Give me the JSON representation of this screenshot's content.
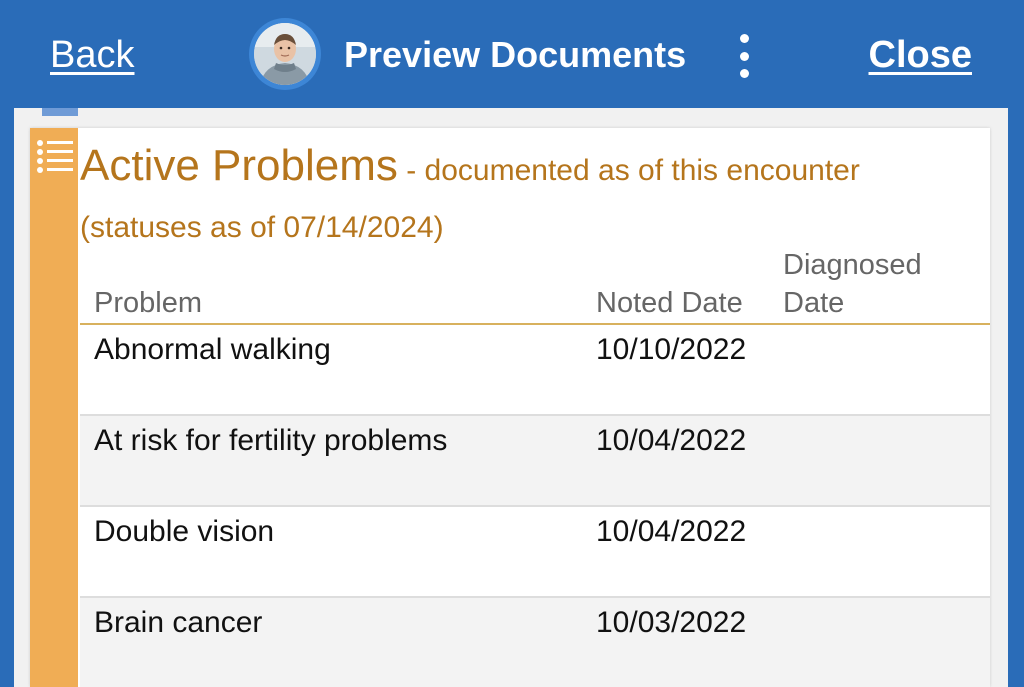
{
  "header": {
    "back_label": "Back",
    "title": "Preview Documents",
    "close_label": "Close"
  },
  "section": {
    "title": "Active Problems",
    "subtitle": " - documented as of this encounter (statuses as of 07/14/2024)"
  },
  "table": {
    "columns": [
      "Problem",
      "Noted Date",
      "Diagnosed Date"
    ],
    "rows": [
      {
        "problem": "Abnormal walking",
        "noted": "10/10/2022",
        "diagnosed": ""
      },
      {
        "problem": "At risk for fertility problems",
        "noted": "10/04/2022",
        "diagnosed": ""
      },
      {
        "problem": "Double vision",
        "noted": "10/04/2022",
        "diagnosed": ""
      },
      {
        "problem": "Brain cancer",
        "noted": "10/03/2022",
        "diagnosed": ""
      }
    ]
  },
  "colors": {
    "header_bg": "#2a6cb8",
    "accent_orange": "#f0ad55",
    "title_color": "#b5751c"
  }
}
